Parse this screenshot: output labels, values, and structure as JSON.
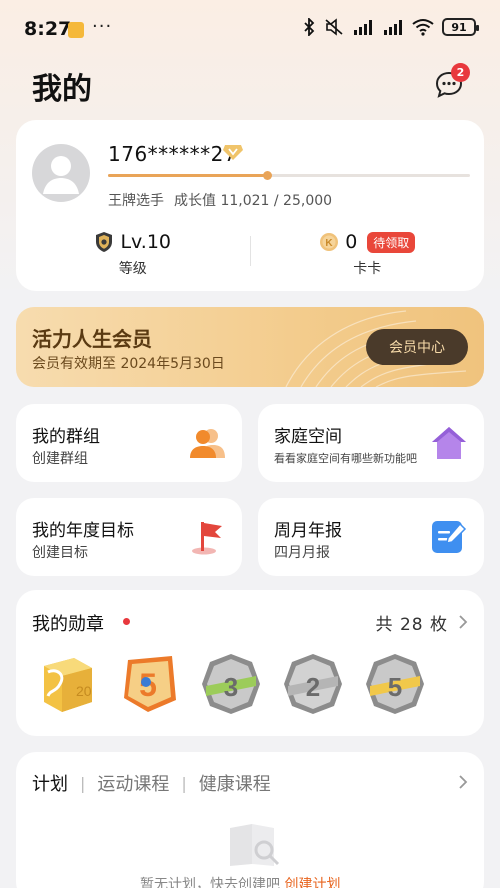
{
  "status_bar": {
    "time": "8:27",
    "dots": "···",
    "battery": "91"
  },
  "header": {
    "title": "我的",
    "message_badge": "2"
  },
  "profile": {
    "phone": "176******27",
    "rank": "王牌选手",
    "growth": "成长值 11,021 / 25,000",
    "growth_progress": 0.44,
    "level_value": "Lv.10",
    "level_label": "等级",
    "card_value": "0",
    "card_badge": "待领取",
    "card_label": "卡卡"
  },
  "membership": {
    "title": "活力人生会员",
    "expire": "会员有效期至 2024年5月30日",
    "button": "会员中心"
  },
  "tiles": {
    "groups": {
      "title": "我的群组",
      "sub": "创建群组"
    },
    "family": {
      "title": "家庭空间",
      "sub": "看看家庭空间有哪些新功能吧"
    },
    "goals": {
      "title": "我的年度目标",
      "sub": "创建目标"
    },
    "report": {
      "title": "周月年报",
      "sub": "四月月报"
    }
  },
  "medals": {
    "title": "我的勋章",
    "count": "共 28 枚"
  },
  "plan": {
    "tabs": [
      "计划",
      "运动课程",
      "健康课程"
    ],
    "separator": "|",
    "empty_text": "暂无计划，快去创建吧",
    "create_link": "创建计划"
  },
  "colors": {
    "accent_orange": "#e9a458",
    "badge_red": "#e8383d",
    "member_gold": "#f3cc8d",
    "create_link": "#e8651f"
  }
}
